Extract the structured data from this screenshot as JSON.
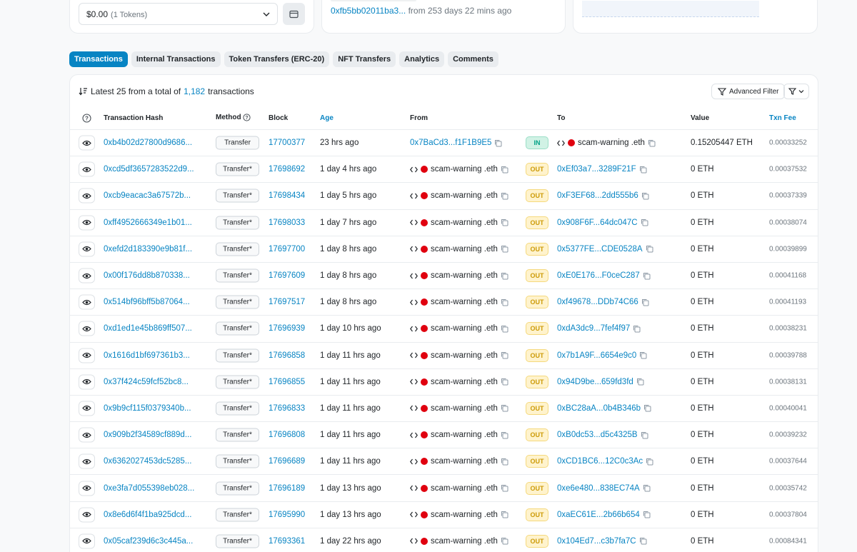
{
  "overview": {
    "token_value": "$0.00",
    "token_count": "(1 Tokens)",
    "first_txn_hash": "0xfb5bb02011ba3...",
    "first_txn_age": "from 253 days 22 mins ago"
  },
  "tabs": [
    {
      "label": "Transactions",
      "active": true
    },
    {
      "label": "Internal Transactions",
      "active": false
    },
    {
      "label": "Token Transfers (ERC-20)",
      "active": false
    },
    {
      "label": "NFT Transfers",
      "active": false
    },
    {
      "label": "Analytics",
      "active": false
    },
    {
      "label": "Comments",
      "active": false
    }
  ],
  "summary": {
    "prefix": "Latest 25 from a total of",
    "total": "1,182",
    "suffix": "transactions"
  },
  "toolbar": {
    "advanced_filter": "Advanced Filter"
  },
  "columns": {
    "hash": "Transaction Hash",
    "method": "Method",
    "block": "Block",
    "age": "Age",
    "from": "From",
    "to": "To",
    "value": "Value",
    "fee": "Txn Fee"
  },
  "colors": {
    "accent": "#0784c3",
    "out": "#cc9a06",
    "in": "#00a186",
    "warning_dot": "#e0000f"
  },
  "rows": [
    {
      "hash": "0xb4b02d27800d9686...",
      "method": "Transfer",
      "block": "17700377",
      "age": "23 hrs ago",
      "from": "0x7BaCd3...f1F1B9E5",
      "from_is_link": true,
      "dir": "IN",
      "to": "scam-warning .eth",
      "to_is_link": false,
      "value": "0.15205447 ETH",
      "fee": "0.00033252"
    },
    {
      "hash": "0xcd5df3657283522d9...",
      "method": "Transfer*",
      "block": "17698692",
      "age": "1 day 4 hrs ago",
      "from": "scam-warning .eth",
      "from_is_link": false,
      "dir": "OUT",
      "to": "0xEf03a7...3289F21F",
      "to_is_link": true,
      "value": "0 ETH",
      "fee": "0.00037532"
    },
    {
      "hash": "0xcb9eacac3a67572b...",
      "method": "Transfer*",
      "block": "17698434",
      "age": "1 day 5 hrs ago",
      "from": "scam-warning .eth",
      "from_is_link": false,
      "dir": "OUT",
      "to": "0xF3EF68...2dd555b6",
      "to_is_link": true,
      "value": "0 ETH",
      "fee": "0.00037339"
    },
    {
      "hash": "0xff4952666349e1b01...",
      "method": "Transfer*",
      "block": "17698033",
      "age": "1 day 7 hrs ago",
      "from": "scam-warning .eth",
      "from_is_link": false,
      "dir": "OUT",
      "to": "0x908F6F...64dc047C",
      "to_is_link": true,
      "value": "0 ETH",
      "fee": "0.00038074"
    },
    {
      "hash": "0xefd2d183390e9b81f...",
      "method": "Transfer*",
      "block": "17697700",
      "age": "1 day 8 hrs ago",
      "from": "scam-warning .eth",
      "from_is_link": false,
      "dir": "OUT",
      "to": "0x5377FE...CDE0528A",
      "to_is_link": true,
      "value": "0 ETH",
      "fee": "0.00039899"
    },
    {
      "hash": "0x00f176dd8b870338...",
      "method": "Transfer*",
      "block": "17697609",
      "age": "1 day 8 hrs ago",
      "from": "scam-warning .eth",
      "from_is_link": false,
      "dir": "OUT",
      "to": "0xE0E176...F0ceC287",
      "to_is_link": true,
      "value": "0 ETH",
      "fee": "0.00041168"
    },
    {
      "hash": "0x514bf96bff5b87064...",
      "method": "Transfer*",
      "block": "17697517",
      "age": "1 day 8 hrs ago",
      "from": "scam-warning .eth",
      "from_is_link": false,
      "dir": "OUT",
      "to": "0xf49678...DDb74C66",
      "to_is_link": true,
      "value": "0 ETH",
      "fee": "0.00041193"
    },
    {
      "hash": "0xd1ed1e45b869ff507...",
      "method": "Transfer*",
      "block": "17696939",
      "age": "1 day 10 hrs ago",
      "from": "scam-warning .eth",
      "from_is_link": false,
      "dir": "OUT",
      "to": "0xdA3dc9...7fef4f97",
      "to_is_link": true,
      "value": "0 ETH",
      "fee": "0.00038231"
    },
    {
      "hash": "0x1616d1bf697361b3...",
      "method": "Transfer*",
      "block": "17696858",
      "age": "1 day 11 hrs ago",
      "from": "scam-warning .eth",
      "from_is_link": false,
      "dir": "OUT",
      "to": "0x7b1A9F...6654e9c0",
      "to_is_link": true,
      "value": "0 ETH",
      "fee": "0.00039788"
    },
    {
      "hash": "0x37f424c59fcf52bc8...",
      "method": "Transfer*",
      "block": "17696855",
      "age": "1 day 11 hrs ago",
      "from": "scam-warning .eth",
      "from_is_link": false,
      "dir": "OUT",
      "to": "0x94D9be...659fd3fd",
      "to_is_link": true,
      "value": "0 ETH",
      "fee": "0.00038131"
    },
    {
      "hash": "0x9b9cf115f0379340b...",
      "method": "Transfer*",
      "block": "17696833",
      "age": "1 day 11 hrs ago",
      "from": "scam-warning .eth",
      "from_is_link": false,
      "dir": "OUT",
      "to": "0xBC28aA...0b4B346b",
      "to_is_link": true,
      "value": "0 ETH",
      "fee": "0.00040041"
    },
    {
      "hash": "0x909b2f34589cf889d...",
      "method": "Transfer*",
      "block": "17696808",
      "age": "1 day 11 hrs ago",
      "from": "scam-warning .eth",
      "from_is_link": false,
      "dir": "OUT",
      "to": "0xB0dc53...d5c4325B",
      "to_is_link": true,
      "value": "0 ETH",
      "fee": "0.00039232"
    },
    {
      "hash": "0x6362027453dc5285...",
      "method": "Transfer*",
      "block": "17696689",
      "age": "1 day 11 hrs ago",
      "from": "scam-warning .eth",
      "from_is_link": false,
      "dir": "OUT",
      "to": "0xCD1BC6...12C0c3Ac",
      "to_is_link": true,
      "value": "0 ETH",
      "fee": "0.00037644"
    },
    {
      "hash": "0xe3fa7d055398eb028...",
      "method": "Transfer*",
      "block": "17696189",
      "age": "1 day 13 hrs ago",
      "from": "scam-warning .eth",
      "from_is_link": false,
      "dir": "OUT",
      "to": "0xe6e480...838EC74A",
      "to_is_link": true,
      "value": "0 ETH",
      "fee": "0.00035742"
    },
    {
      "hash": "0x8e6d6f4f1ba925dcd...",
      "method": "Transfer*",
      "block": "17695990",
      "age": "1 day 13 hrs ago",
      "from": "scam-warning .eth",
      "from_is_link": false,
      "dir": "OUT",
      "to": "0xaEC61E...2b66b654",
      "to_is_link": true,
      "value": "0 ETH",
      "fee": "0.00037804"
    },
    {
      "hash": "0x05caf239d6c3c445a...",
      "method": "Transfer*",
      "block": "17693361",
      "age": "1 day 22 hrs ago",
      "from": "scam-warning .eth",
      "from_is_link": false,
      "dir": "OUT",
      "to": "0x104Ed7...c3b7fa7C",
      "to_is_link": true,
      "value": "0 ETH",
      "fee": "0.00084341"
    }
  ]
}
